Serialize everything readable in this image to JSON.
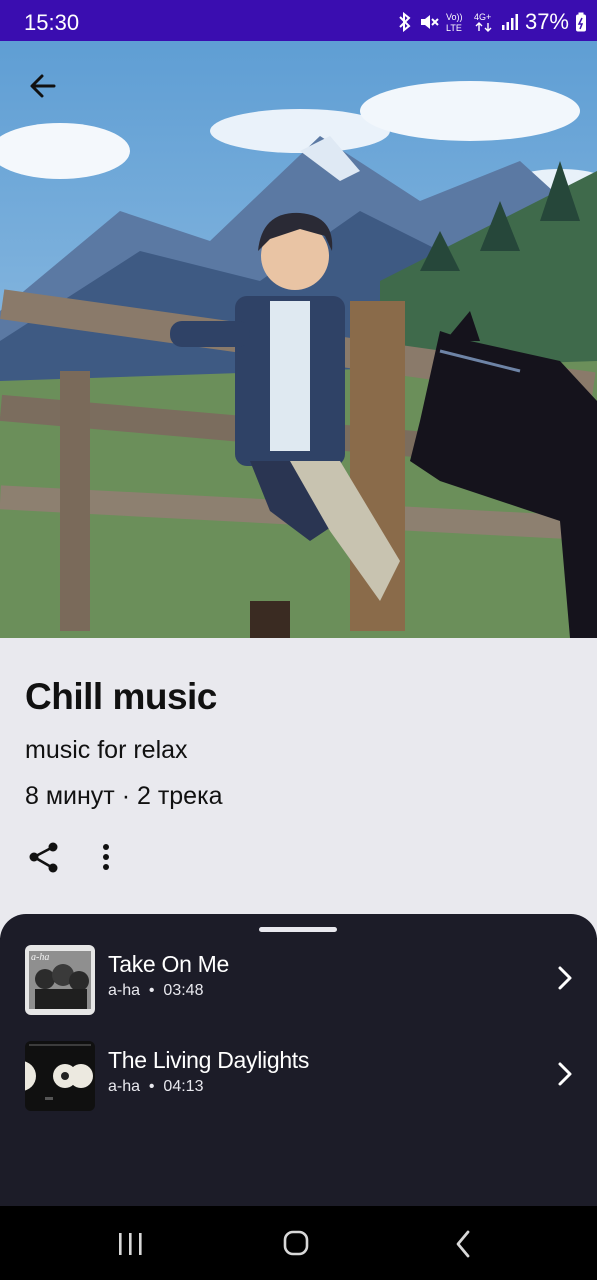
{
  "status_bar": {
    "time": "15:30",
    "network": "Vo)) LTE",
    "signal": "4G+",
    "battery": "37%",
    "icons": [
      "bluetooth-icon",
      "mute-icon",
      "volte-icon",
      "4g-icon",
      "signal-icon",
      "battery-icon"
    ]
  },
  "playlist": {
    "title": "Chill music",
    "description": "music for relax",
    "meta": "8 минут · 2 трека"
  },
  "tracks": [
    {
      "title": "Take On Me",
      "artist": "a-ha",
      "duration": "03:48",
      "cover_text": "a-ha"
    },
    {
      "title": "The Living Daylights",
      "artist": "a-ha",
      "duration": "04:13"
    }
  ],
  "colors": {
    "status_bar": "#3a0db0",
    "info_bg": "#e9e9ee",
    "sheet_bg": "#1c1c28",
    "nav_bg": "#000000"
  }
}
